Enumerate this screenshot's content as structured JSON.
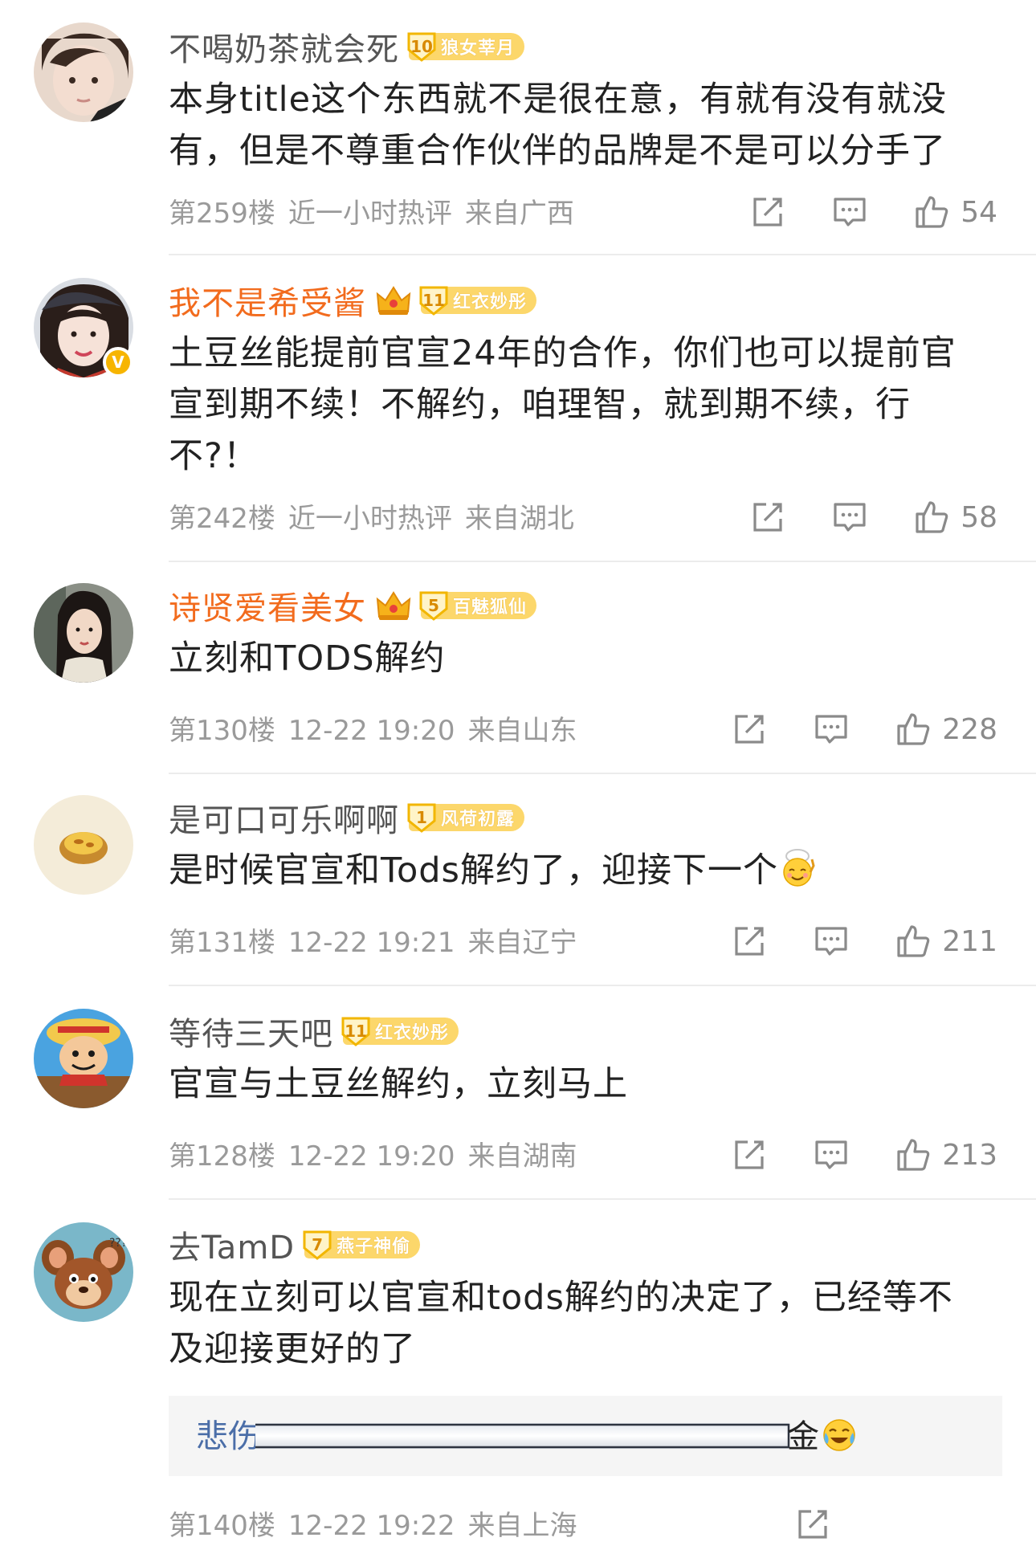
{
  "comments": [
    {
      "username": "不喝奶茶就会死",
      "badge": {
        "level": "10",
        "title": "狼女莘月"
      },
      "content": "本身title这个东西就不是很在意，有就有没有就没\n有，但是不尊重合作伙伴的品牌是不是可以分手了",
      "floor": "第259楼",
      "time": "近一小时热评",
      "location": "来自广西",
      "likes": "54"
    },
    {
      "username": "我不是希受酱",
      "badge": {
        "level": "11",
        "title": "红衣妙彤"
      },
      "content": "土豆丝能提前官宣24年的合作，你们也可以提前官\n宣到期不续！不解约，咱理智，就到期不续，行\n不?！",
      "floor": "第242楼",
      "time": "近一小时热评",
      "location": "来自湖北",
      "likes": "58"
    },
    {
      "username": "诗贤爱看美女",
      "badge": {
        "level": "5",
        "title": "百魅狐仙"
      },
      "content": "立刻和TODS解约",
      "floor": "第130楼",
      "time": "12-22 19:20",
      "location": "来自山东",
      "likes": "228"
    },
    {
      "username": "是可口可乐啊啊",
      "badge": {
        "level": "1",
        "title": "风荷初露"
      },
      "content": "是时候官宣和Tods解约了，迎接下一个",
      "floor": "第131楼",
      "time": "12-22 19:21",
      "location": "来自辽宁",
      "likes": "211"
    },
    {
      "username": "等待三天吧",
      "badge": {
        "level": "11",
        "title": "红衣妙彤"
      },
      "content": "官宣与土豆丝解约，立刻马上",
      "floor": "第128楼",
      "time": "12-22 19:20",
      "location": "来自湖南",
      "likes": "213"
    },
    {
      "username": "去TamD",
      "badge": {
        "level": "7",
        "title": "燕子神偷"
      },
      "content": "现在立刻可以官宣和tods解约的决定了，已经等不\n及迎接更好的了",
      "reply": {
        "author": "悲伤",
        "tail": "金"
      },
      "floor": "第140楼",
      "time": "12-22 19:22",
      "location": "来自上海"
    }
  ],
  "icons": {
    "share": "share-icon",
    "comment": "comment-icon",
    "like": "thumbs-up-icon",
    "crown": "crown-icon",
    "verified": "verified-v-icon"
  },
  "colors": {
    "vip_name": "#f26b1d",
    "badge_bg": "#fcd76b",
    "meta_text": "#9a9a9a",
    "reply_link": "#4b6ea8"
  }
}
